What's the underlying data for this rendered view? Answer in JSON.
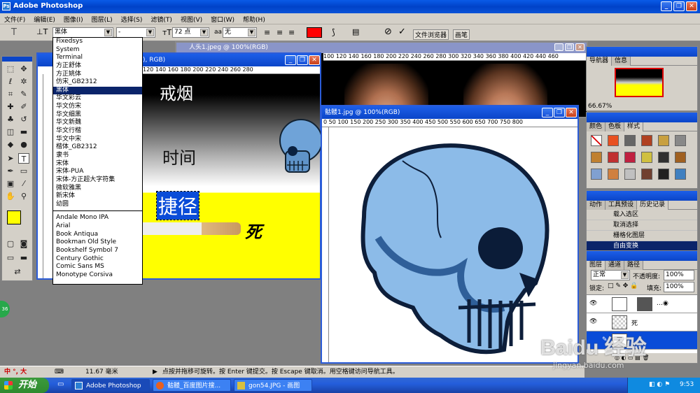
{
  "app": {
    "title": "Adobe Photoshop"
  },
  "menu": [
    "文件(F)",
    "编辑(E)",
    "图像(I)",
    "图层(L)",
    "选择(S)",
    "滤镜(T)",
    "视图(V)",
    "窗口(W)",
    "帮助(H)"
  ],
  "options": {
    "font_family": "黑体",
    "font_style": "-",
    "font_size": "72 点",
    "antialias_label": "aa",
    "antialias": "无",
    "color": "#ff0000",
    "palette_tabs": [
      "文件浏览器",
      "画笔"
    ]
  },
  "font_list": {
    "items": [
      "Fixedsys",
      "System",
      "Terminal",
      "方正舒体",
      "方正姚体",
      "仿宋_GB2312",
      "黑体",
      "华文彩云",
      "华文仿宋",
      "华文细黑",
      "华文新魏",
      "华文行楷",
      "华文中宋",
      "楷体_GB2312",
      "隶书",
      "宋体",
      "宋体-PUA",
      "宋体-方正超大字符集",
      "微软雅黑",
      "新宋体",
      "幼圆"
    ],
    "items2": [
      "Andale Mono IPA",
      "Arial",
      "Book Antiqua",
      "Bookman Old Style",
      "Bookshelf Symbol 7",
      "Century Gothic",
      "Comic Sans MS",
      "Monotype Corsiva"
    ],
    "selected": "黑体"
  },
  "doc1": {
    "title_fragment": "), RGB)",
    "ruler": "120  140  160  180  200  220  240  260  280",
    "text_smoking": "戒烟",
    "text_time": "时间",
    "text_shortcut": "捷径",
    "text_death": "死"
  },
  "doc_back": {
    "title": "人头1.jpeg @ 100%(RGB)",
    "ruler": "100  120  140  160  180  200  220  240  260  280  300  320  340  360  380  400  420  440  460"
  },
  "doc2": {
    "title": "骷髅1.jpg @ 100%(RGB)",
    "ruler": "0    50    100    150    200    250    300    350    400    450    500    550    600    650    700    750    800"
  },
  "navigator": {
    "tabs": [
      "导航器",
      "信息"
    ],
    "zoom": "66.67%"
  },
  "swatches": {
    "tabs": [
      "颜色",
      "色板",
      "样式"
    ]
  },
  "history": {
    "tabs": [
      "动作",
      "工具预设",
      "历史记录"
    ],
    "items": [
      "载入选区",
      "取消选择",
      "栅格化图层",
      "自由变换"
    ]
  },
  "layers": {
    "tabs": [
      "图层",
      "通道",
      "路径"
    ],
    "blend_mode": "正常",
    "opacity_label": "不透明度:",
    "opacity": "100%",
    "lock_label": "锁定:",
    "fill_label": "填充:",
    "fill": "100%",
    "layer_death": "死",
    "text_layer_glyph": "T"
  },
  "status": {
    "ime": "中 °, 大",
    "measure": "11.67 毫米",
    "hint": "点按并拖移可旋转。按 Enter 键提交。按 Escape 键取消。用空格键访问导航工具。",
    "badge": "36"
  },
  "taskbar": {
    "start": "开始",
    "tasks": [
      "Adobe Photoshop",
      "骷髅_百度图片搜...",
      "gon54.JPG - 画图"
    ],
    "clock": "9:53"
  },
  "watermark": {
    "brand": "Baidu 经验",
    "url": "jingyan.baidu.com"
  }
}
